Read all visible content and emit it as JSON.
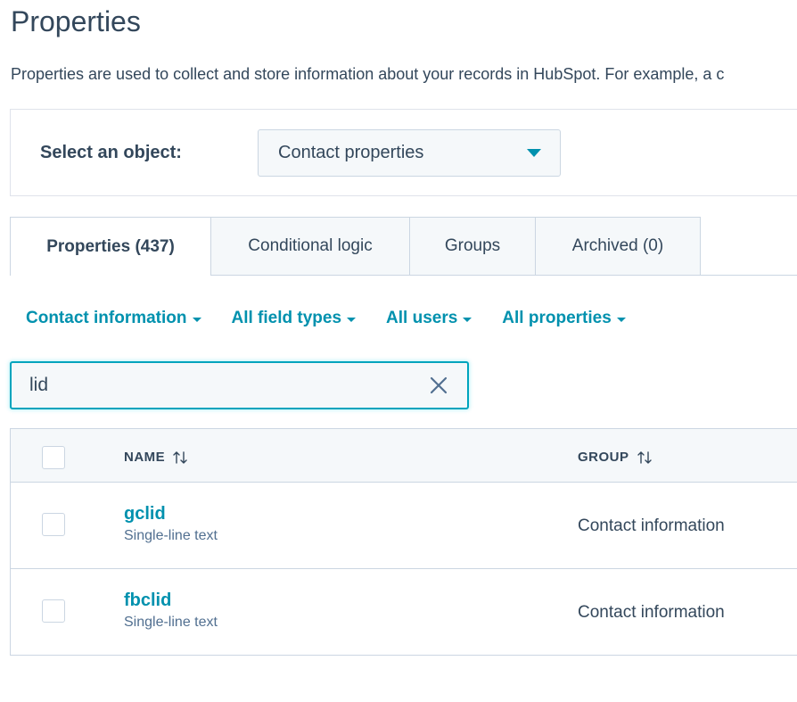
{
  "page": {
    "title": "Properties",
    "description": "Properties are used to collect and store information about your records in HubSpot. For example, a c"
  },
  "object_selector": {
    "label": "Select an object:",
    "value": "Contact properties"
  },
  "tabs": [
    {
      "label": "Properties (437)",
      "active": true
    },
    {
      "label": "Conditional logic",
      "active": false
    },
    {
      "label": "Groups",
      "active": false
    },
    {
      "label": "Archived (0)",
      "active": false
    }
  ],
  "filters": [
    {
      "label": "Contact information"
    },
    {
      "label": "All field types"
    },
    {
      "label": "All users"
    },
    {
      "label": "All properties"
    }
  ],
  "search": {
    "value": "lid"
  },
  "table": {
    "columns": [
      {
        "label": "NAME"
      },
      {
        "label": "GROUP"
      }
    ],
    "rows": [
      {
        "name": "gclid",
        "type": "Single-line text",
        "group": "Contact information",
        "checked": false
      },
      {
        "name": "fbclid",
        "type": "Single-line text",
        "group": "Contact information",
        "checked": false
      }
    ]
  },
  "colors": {
    "accent": "#0091ae",
    "text": "#33475b",
    "subtle_text": "#516f90",
    "border": "#cbd6e2",
    "panel_bg": "#f5f8fa",
    "focus_border": "#00a4bd"
  },
  "icons": {
    "select_caret": "chevron-down-icon",
    "filter_caret": "chevron-down-icon",
    "clear": "close-icon",
    "sort": "sort-icon"
  }
}
